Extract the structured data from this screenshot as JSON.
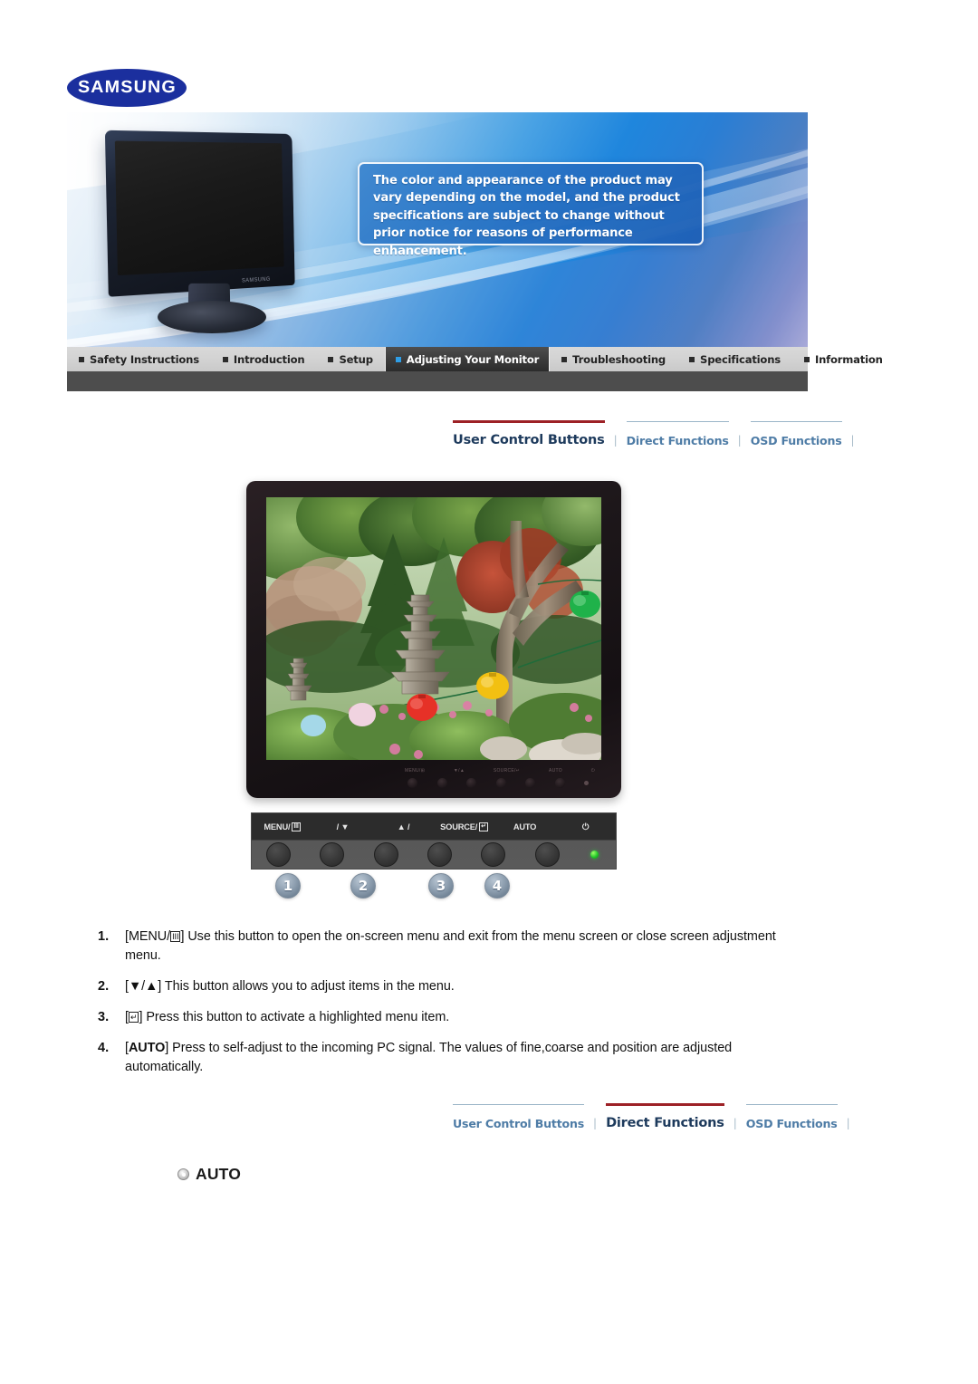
{
  "brand": {
    "logo_text": "SAMSUNG",
    "logo_color": "#1b2f9e"
  },
  "hero": {
    "notice": "The color and appearance of the product may vary depending on the model, and the product specifications are subject to change without prior notice for reasons of performance enhancement.",
    "monitor_brand_mark": "SAMSUNG"
  },
  "mainnav": {
    "items": [
      {
        "label": "Safety Instructions",
        "active": false
      },
      {
        "label": "Introduction",
        "active": false
      },
      {
        "label": "Setup",
        "active": false
      },
      {
        "label": "Adjusting Your Monitor",
        "active": true
      },
      {
        "label": "Troubleshooting",
        "active": false
      },
      {
        "label": "Specifications",
        "active": false
      },
      {
        "label": "Information",
        "active": false
      }
    ]
  },
  "subnav_top": {
    "tabs": [
      {
        "label": "User Control Buttons",
        "active": true
      },
      {
        "label": "Direct Functions",
        "active": false
      },
      {
        "label": "OSD Functions",
        "active": false
      }
    ],
    "separator": "|"
  },
  "subnav_bottom": {
    "tabs": [
      {
        "label": "User Control Buttons",
        "active": false
      },
      {
        "label": "Direct Functions",
        "active": true
      },
      {
        "label": "OSD Functions",
        "active": false
      }
    ],
    "separator": "|"
  },
  "control_panel": {
    "labels": [
      {
        "text": "MENU/",
        "glyph": "III"
      },
      {
        "text": "/ ▼",
        "glyph": ""
      },
      {
        "text": "▲ /",
        "glyph": ""
      },
      {
        "text": "SOURCE/",
        "glyph": "↵"
      },
      {
        "text": "AUTO",
        "glyph": ""
      },
      {
        "text": "⏻",
        "glyph": ""
      }
    ],
    "button_count": 6,
    "led_color": "#24c72a"
  },
  "callouts": [
    {
      "number": "1"
    },
    {
      "number": "2"
    },
    {
      "number": "3"
    },
    {
      "number": "4"
    }
  ],
  "steps": [
    {
      "num": "1.",
      "prefix": "[MENU/",
      "glyph": "III",
      "suffix": "] Use this button to open the on-screen menu and exit from the menu screen or close screen adjustment menu."
    },
    {
      "num": "2.",
      "prefix": "[▼/▲] ",
      "glyph": "",
      "suffix": "This button allows you to adjust items in the menu."
    },
    {
      "num": "3.",
      "prefix": "[",
      "glyph": "↵",
      "suffix": "] Press this button to activate a highlighted menu item."
    },
    {
      "num": "4.",
      "prefix": "[AUTO] ",
      "glyph": "",
      "suffix": "Press to self-adjust to the incoming PC signal. The values of fine,coarse and position are adjusted automatically."
    }
  ],
  "auto_section": {
    "heading": "AUTO"
  },
  "colors": {
    "accent_red": "#9d2126",
    "nav_bar": "#d2d2d2",
    "nav_strip": "#4d4d4d",
    "active_tab_bg": "#3c3c3c",
    "link_blue": "#4e7ca6"
  }
}
